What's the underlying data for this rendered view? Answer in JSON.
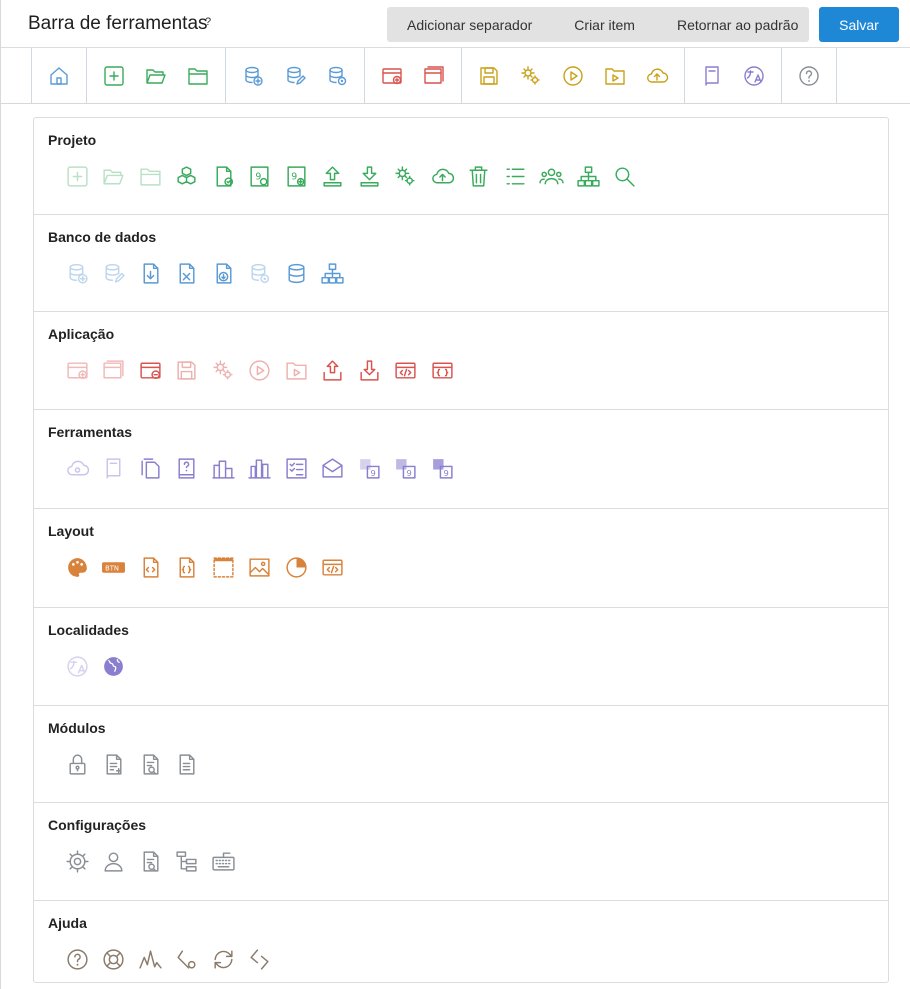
{
  "header": {
    "title": "Barra de ferramentas",
    "help": "?",
    "actions": [
      "Adicionar separador",
      "Criar item",
      "Retornar ao padrão"
    ],
    "save_label": "Salvar"
  },
  "colors": {
    "green": "#3aaa5c",
    "blue": "#5b9bd5",
    "red": "#d9534f",
    "yellow": "#c9a21a",
    "purple": "#8a7fcf",
    "orange": "#d9823b",
    "gray": "#8a8f96",
    "brown": "#8a7a6a",
    "save": "#1e88d6"
  },
  "toolbar_preview": [
    [
      "home-icon"
    ],
    [
      "add-icon",
      "folder-open-icon",
      "folder-icon"
    ],
    [
      "database-add-icon",
      "database-edit-icon",
      "database-settings-icon"
    ],
    [
      "app-add-icon",
      "app-window-icon"
    ],
    [
      "save-icon",
      "gears-icon",
      "play-icon",
      "folder-play-icon",
      "cloud-upload-icon"
    ],
    [
      "book-icon",
      "translate-icon"
    ],
    [
      "help-icon"
    ]
  ],
  "sections": [
    {
      "title": "Projeto",
      "color": "green",
      "icons": [
        "add-icon",
        "folder-open-icon",
        "folder-icon",
        "cubes-icon",
        "file-check-icon",
        "file-nine-icon",
        "file-nine-add-icon",
        "upload-icon",
        "download-icon",
        "gears-icon",
        "cloud-upload-icon",
        "trash-icon",
        "list-icon",
        "users-icon",
        "sitemap-icon",
        "search-icon"
      ]
    },
    {
      "title": "Banco de dados",
      "color": "blue",
      "icons": [
        "database-add-icon",
        "database-edit-icon",
        "file-import-icon",
        "file-export-icon",
        "file-down-icon",
        "database-settings-icon",
        "database-icon",
        "sitemap-icon"
      ]
    },
    {
      "title": "Aplicação",
      "color": "red",
      "icons": [
        "app-add-icon",
        "app-window-icon",
        "app-remove-icon",
        "save-icon",
        "gears-icon",
        "play-icon",
        "folder-play-icon",
        "upload-box-icon",
        "download-box-icon",
        "code-window-icon",
        "json-window-icon"
      ]
    },
    {
      "title": "Ferramentas",
      "color": "purple",
      "icons": [
        "cloud-settings-icon",
        "book-icon",
        "files-icon",
        "help-book-icon",
        "buildings-icon",
        "buildings-alt-icon",
        "checklist-icon",
        "mail-icon",
        "nine-copy-icon",
        "nine-copy-alt-icon",
        "nine-copy-dark-icon"
      ]
    },
    {
      "title": "Layout",
      "color": "orange",
      "icons": [
        "palette-icon",
        "btn-icon",
        "code-file-icon",
        "json-file-icon",
        "frame-icon",
        "image-icon",
        "pie-chart-icon",
        "code-window-icon"
      ]
    },
    {
      "title": "Localidades",
      "color": "purple",
      "icons": [
        "translate-icon",
        "globe-icon"
      ]
    },
    {
      "title": "Módulos",
      "color": "gray",
      "icons": [
        "lock-icon",
        "file-add-icon",
        "file-search-icon",
        "file-text-icon"
      ]
    },
    {
      "title": "Configurações",
      "color": "gray",
      "icons": [
        "settings-icon",
        "user-icon",
        "file-search-icon",
        "tree-icon",
        "keyboard-icon"
      ]
    },
    {
      "title": "Ajuda",
      "color": "brown",
      "icons": [
        "help-icon",
        "lifebuoy-icon",
        "activity-icon",
        "link-settings-icon",
        "refresh-icon",
        "link-icon"
      ]
    }
  ]
}
